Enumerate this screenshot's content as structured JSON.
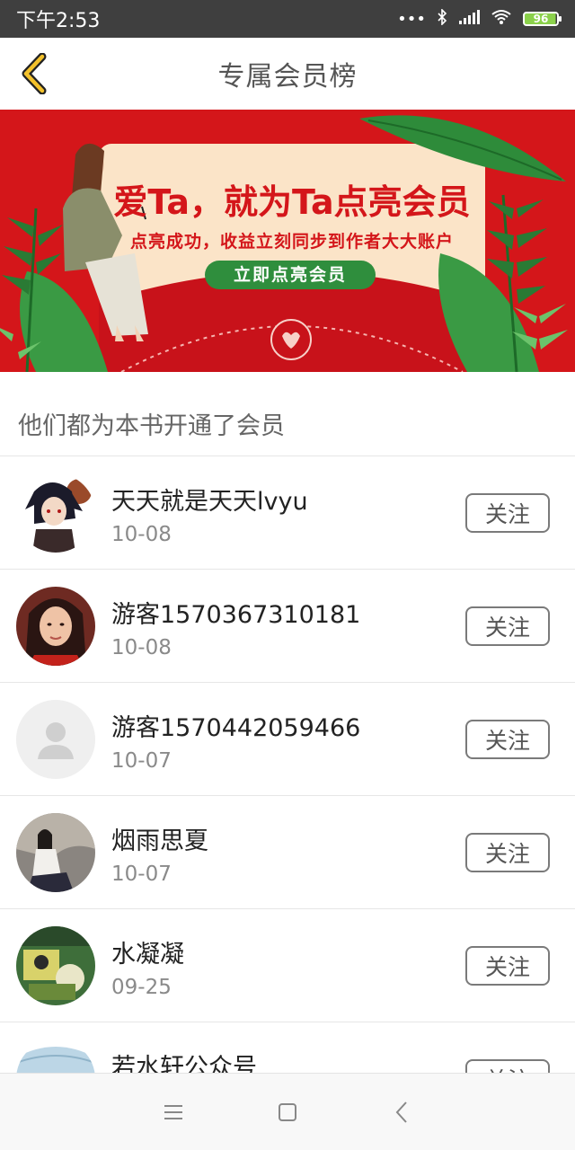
{
  "status_bar": {
    "time": "下午2:53",
    "battery": "96",
    "icons": [
      "more-dots-icon",
      "bluetooth-icon",
      "signal-icon",
      "wifi-icon",
      "battery-icon"
    ]
  },
  "header": {
    "title": "专属会员榜",
    "back_icon": "chevron-left-icon"
  },
  "banner": {
    "headline": "爱Ta，就为Ta点亮会员",
    "subline": "点亮成功，收益立刻同步到作者大大账户",
    "button_label": "立即点亮会员"
  },
  "section": {
    "title": "他们都为本书开通了会员"
  },
  "members": [
    {
      "name": "天天就是天天lvyu",
      "date": "10-08",
      "follow_label": "关注"
    },
    {
      "name": "游客1570367310181",
      "date": "10-08",
      "follow_label": "关注"
    },
    {
      "name": "游客1570442059466",
      "date": "10-07",
      "follow_label": "关注"
    },
    {
      "name": "烟雨思夏",
      "date": "10-07",
      "follow_label": "关注"
    },
    {
      "name": "水凝凝",
      "date": "09-25",
      "follow_label": "关注"
    },
    {
      "name": "若水轩公众号",
      "date": "",
      "follow_label": "关注"
    }
  ],
  "nav_bar": {
    "icons": [
      "menu-icon",
      "home-square-icon",
      "back-triangle-icon"
    ]
  }
}
